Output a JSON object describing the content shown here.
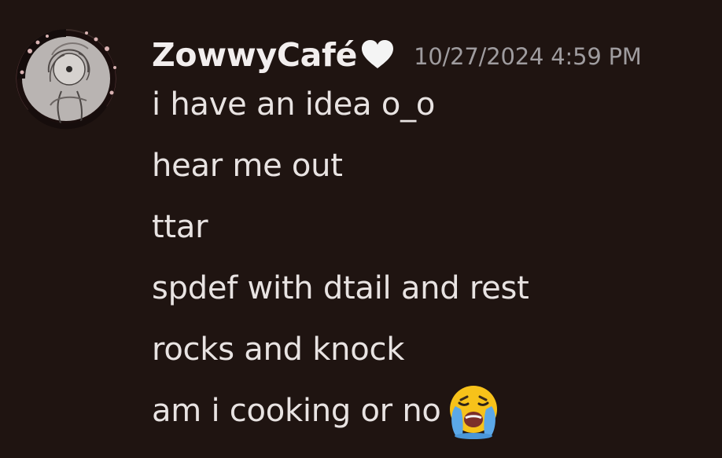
{
  "author": {
    "username": "ZowwyCafé",
    "badge_icon": "white-heart-icon",
    "avatar_icon": "avatar-sketch-icon"
  },
  "timestamp": "10/27/2024 4:59 PM",
  "messages": [
    "i have an idea o_o",
    "hear me out",
    "ttar",
    "spdef with dtail and rest",
    "rocks and knock",
    "am i cooking or no"
  ],
  "emoji": {
    "name": "crying-face-icon"
  },
  "colors": {
    "background": "#1f1411",
    "username": "#f2eeee",
    "timestamp": "#9f9c9f",
    "message_text": "#e8e3e2"
  }
}
